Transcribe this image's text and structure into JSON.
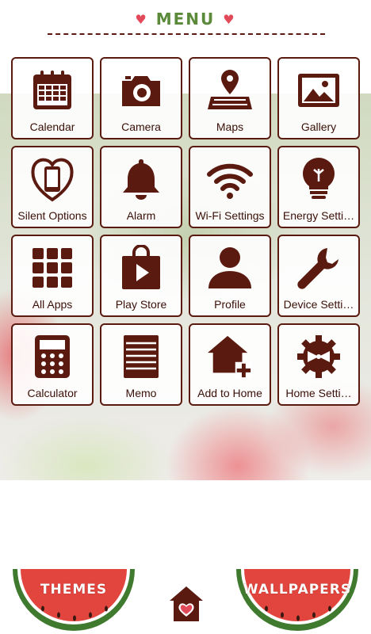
{
  "header": {
    "title": "MENU",
    "left_heart": "♥",
    "right_heart": "♥"
  },
  "apps": [
    {
      "label": "Calendar",
      "icon": "calendar-icon"
    },
    {
      "label": "Camera",
      "icon": "camera-icon"
    },
    {
      "label": "Maps",
      "icon": "map-pin-icon"
    },
    {
      "label": "Gallery",
      "icon": "image-icon"
    },
    {
      "label": "Silent Options",
      "icon": "phone-heart-icon"
    },
    {
      "label": "Alarm",
      "icon": "bell-icon"
    },
    {
      "label": "Wi-Fi Settings",
      "icon": "wifi-icon"
    },
    {
      "label": "Energy Setti…",
      "icon": "lightbulb-icon"
    },
    {
      "label": "All Apps",
      "icon": "app-grid-icon"
    },
    {
      "label": "Play Store",
      "icon": "play-bag-icon"
    },
    {
      "label": "Profile",
      "icon": "person-icon"
    },
    {
      "label": "Device Setti…",
      "icon": "wrench-icon"
    },
    {
      "label": "Calculator",
      "icon": "calculator-icon"
    },
    {
      "label": "Memo",
      "icon": "memo-icon"
    },
    {
      "label": "Add to Home",
      "icon": "home-plus-icon"
    },
    {
      "label": "Home Setti…",
      "icon": "gear-bow-icon"
    }
  ],
  "bottom": {
    "themes_label": "THEMES",
    "wallpapers_label": "WALLPAPERS",
    "home_icon": "house-heart-icon"
  },
  "colors": {
    "icon": "#5a1a10",
    "title_green": "#5b8a3a",
    "heart": "#e24a5a",
    "melon_red": "#e2453e",
    "melon_green": "#3f7a2e"
  }
}
